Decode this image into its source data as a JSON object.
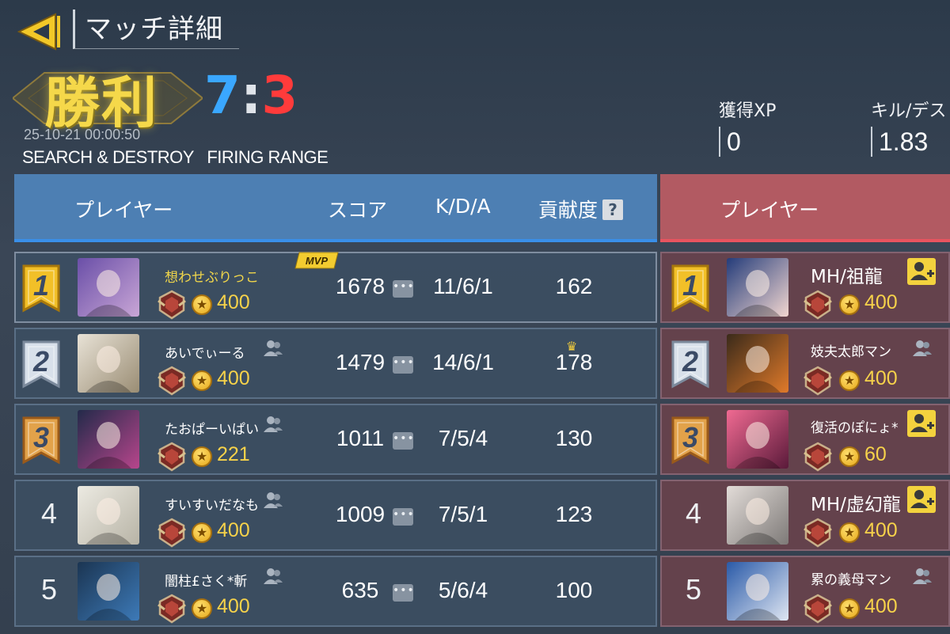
{
  "header": {
    "title": "マッチ詳細",
    "result": "勝利",
    "score_blue": "7",
    "score_sep": ":",
    "score_red": "3",
    "datetime": "25-10-21 00:00:50",
    "mode_map": "SEARCH & DESTROY   FIRING RANGE",
    "stats": [
      {
        "label": "獲得XP",
        "value": "0"
      },
      {
        "label": "キル/デス",
        "value": "1.83"
      }
    ]
  },
  "blue_team": {
    "columns": {
      "player": "プレイヤー",
      "score": "スコア",
      "kda": "K/D/A",
      "contribution": "貢献度",
      "help": "?"
    },
    "mvp_label": "MVP",
    "chat_glyph": "•••",
    "players": [
      {
        "rank": "1",
        "name": "想わせぶりっこ",
        "points": "400",
        "score": "1678",
        "kda": "11/6/1",
        "contribution": "162",
        "mvp": true
      },
      {
        "rank": "2",
        "name": "あいでぃーる",
        "points": "400",
        "score": "1479",
        "kda": "14/6/1",
        "contribution": "178",
        "top_contribution": true
      },
      {
        "rank": "3",
        "name": "たおぱーいぱい",
        "points": "221",
        "score": "1011",
        "kda": "7/5/4",
        "contribution": "130"
      },
      {
        "rank": "4",
        "name": "すいすいだなも",
        "points": "400",
        "score": "1009",
        "kda": "7/5/1",
        "contribution": "123"
      },
      {
        "rank": "5",
        "name": "闇柱£さく*斬",
        "points": "400",
        "score": "635",
        "kda": "5/6/4",
        "contribution": "100"
      }
    ]
  },
  "red_team": {
    "columns": {
      "player": "プレイヤー"
    },
    "players": [
      {
        "rank": "1",
        "name": "MH/祖龍",
        "points": "400",
        "add_friend": true
      },
      {
        "rank": "2",
        "name": "妓夫太郎マン",
        "points": "400"
      },
      {
        "rank": "3",
        "name": "復活のぽにょ*",
        "points": "60",
        "add_friend": true
      },
      {
        "rank": "4",
        "name": "MH/虚幻龍",
        "points": "400",
        "add_friend": true
      },
      {
        "rank": "5",
        "name": "累の義母マン",
        "points": "400"
      }
    ]
  },
  "colors": {
    "blue_team": "#4d7fb3",
    "red_team": "#b25a62",
    "gold": "#f5d84a",
    "score_blue": "#3aa7ff",
    "score_red": "#ff3b3b"
  },
  "icons": [
    "back-arrow-icon",
    "rank-ribbon-icon",
    "rank-medal-icon",
    "coin-icon",
    "friend-icon",
    "add-friend-icon",
    "chat-icon",
    "crown-icon",
    "help-icon"
  ]
}
